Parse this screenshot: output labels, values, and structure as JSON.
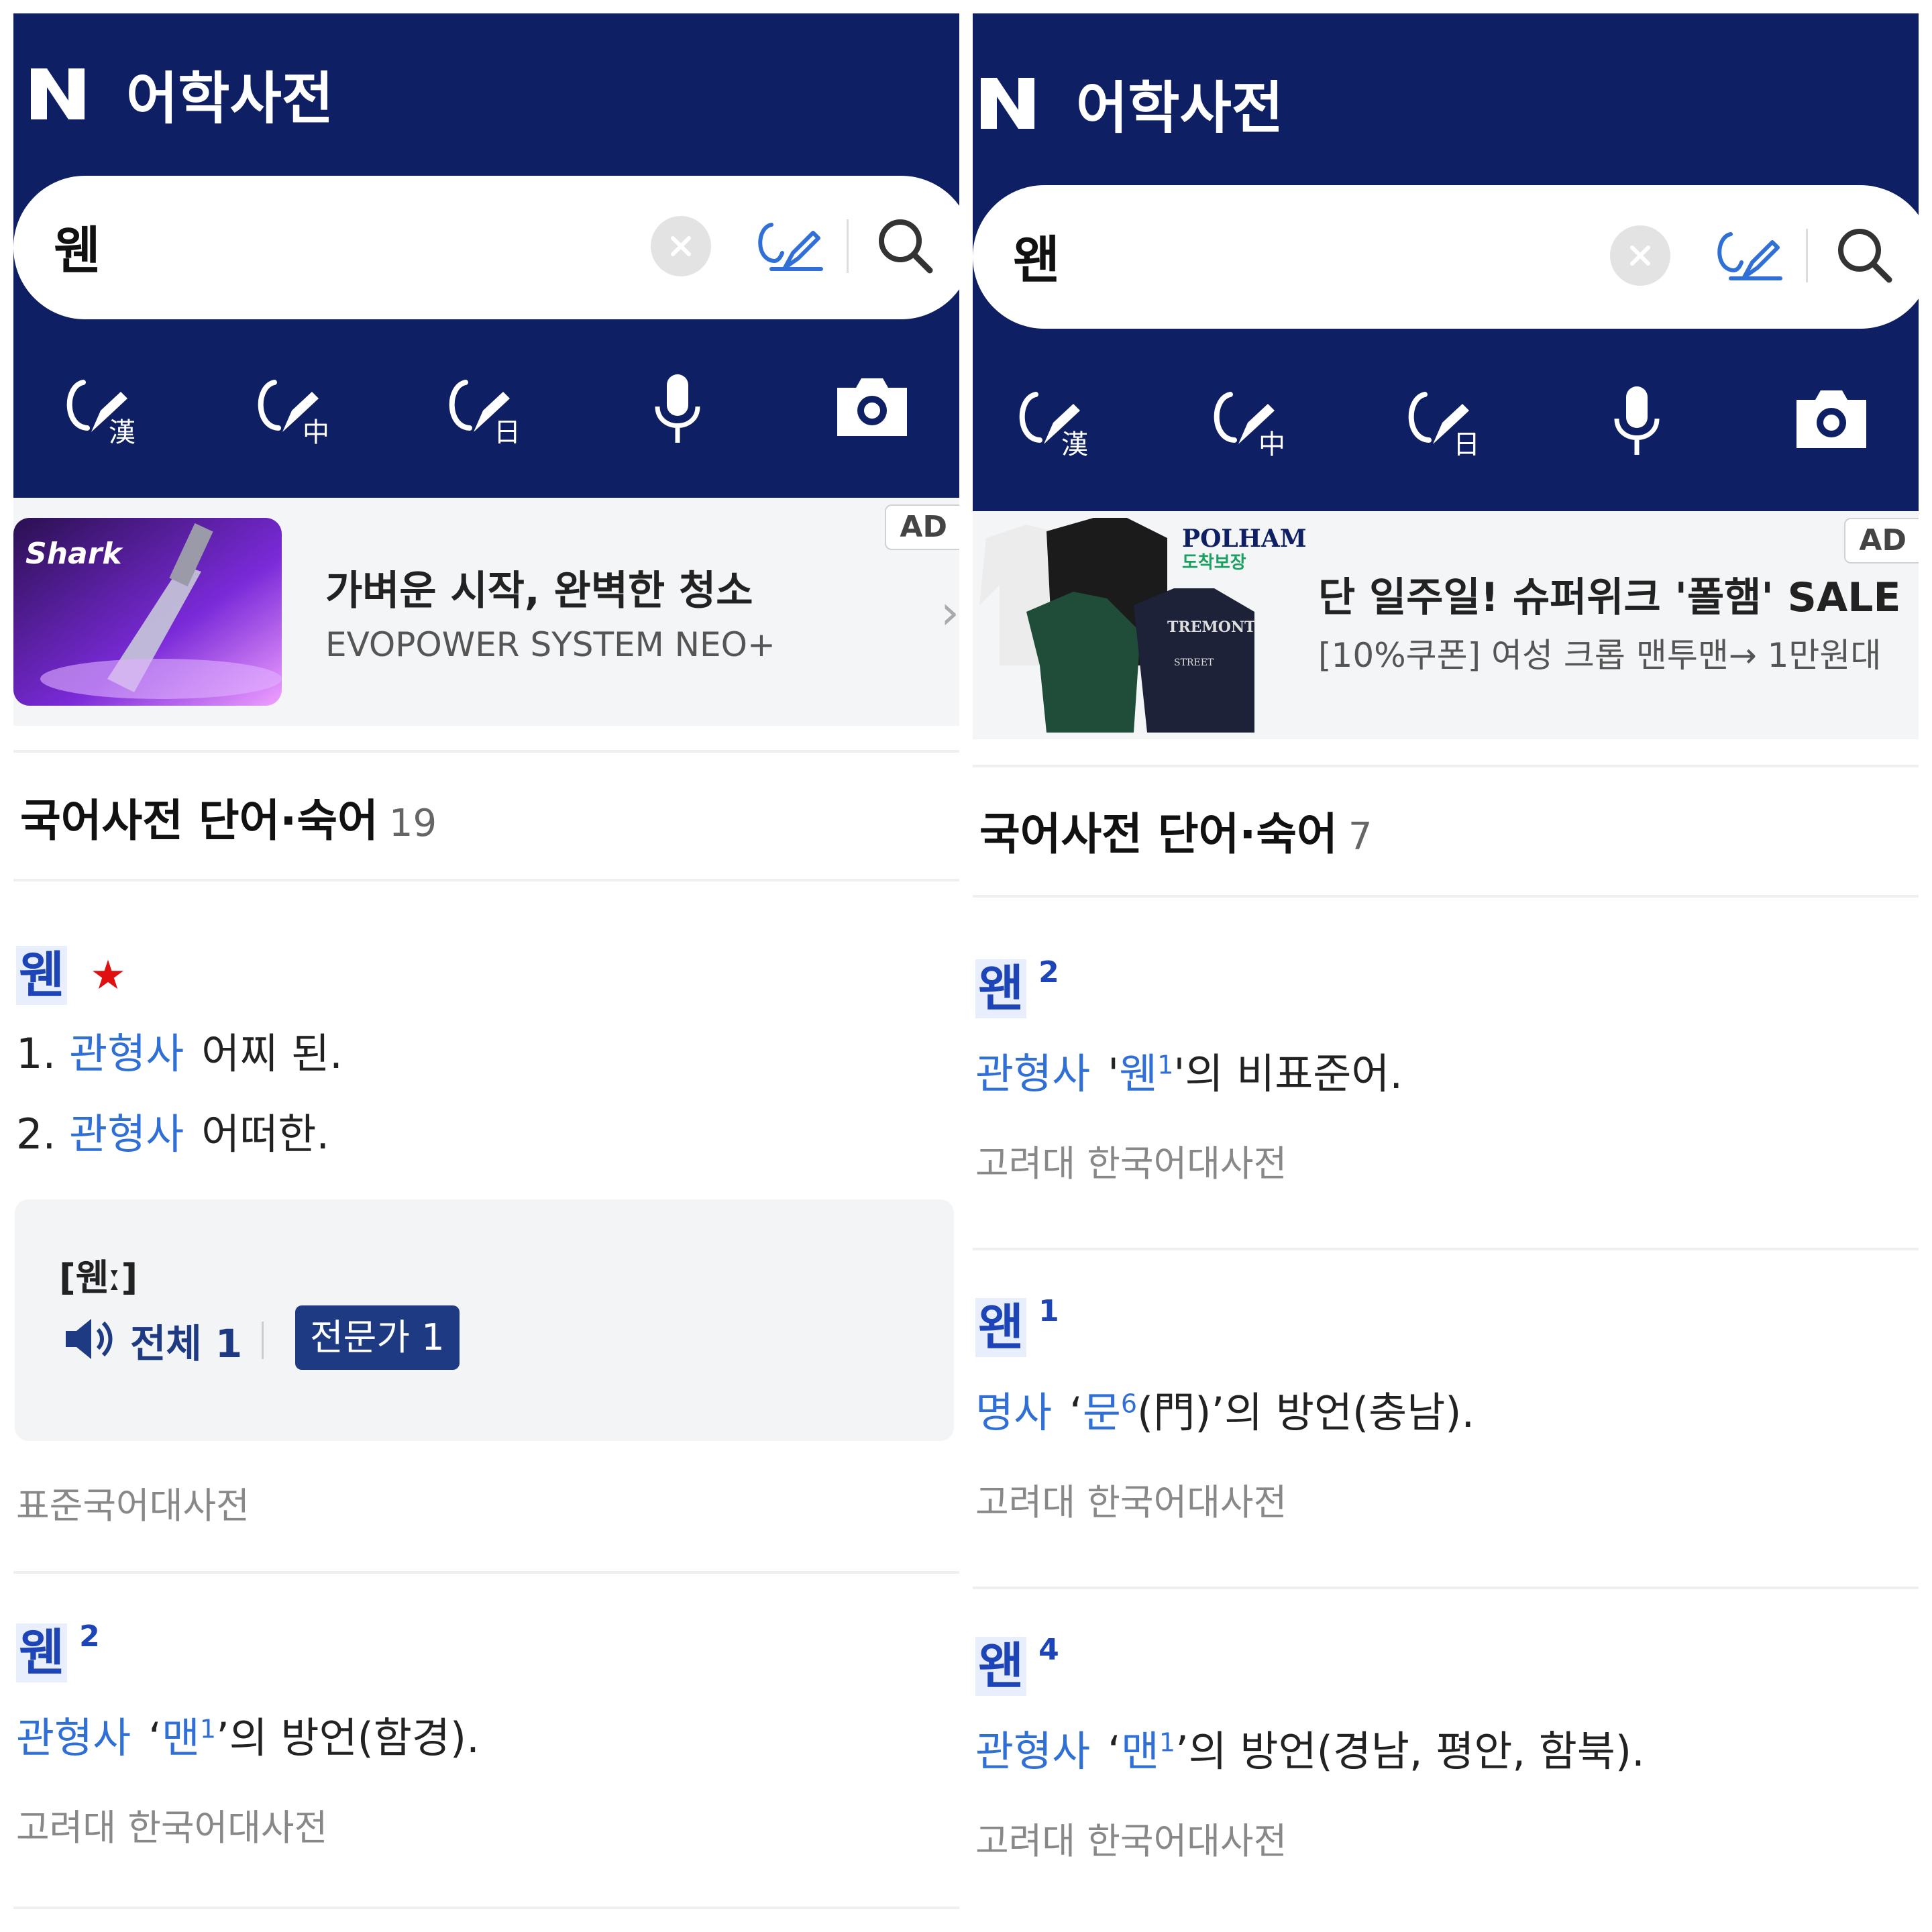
{
  "left": {
    "app_title": "어학사전",
    "search": {
      "value": "웬"
    },
    "ad": {
      "badge": "AD",
      "brand": "Shark",
      "title": "가벼운 시작, 완벽한 청소",
      "subtitle": "EVOPOWER SYSTEM NEO+"
    },
    "section": {
      "title": "국어사전 단어·숙어",
      "count": "19"
    },
    "entries": [
      {
        "term": "웬",
        "senses": [
          {
            "number": "1.",
            "pos": "관형사",
            "text": "어찌 된."
          },
          {
            "number": "2.",
            "pos": "관형사",
            "text": "어떠한."
          }
        ],
        "pronunciation": "[웬ː]",
        "audio_all_label": "전체 1",
        "expert_label": "전문가 1",
        "source": "표준국어대사전"
      },
      {
        "term": "웬",
        "sup": "2",
        "pos": "관형사",
        "ref": "맨",
        "ref_sup": "1",
        "rest": "의 방언(함경).",
        "source": "고려대 한국어대사전"
      }
    ]
  },
  "right": {
    "app_title": "어학사전",
    "search": {
      "value": "왠"
    },
    "ad": {
      "badge": "AD",
      "brand": "POLHAM",
      "brand_tag": "도착보장",
      "title": "단 일주일! 슈퍼위크 '폴햄' SALE",
      "subtitle": "[10%쿠폰] 여성 크롭 맨투맨→ 1만원대"
    },
    "section": {
      "title": "국어사전 단어·숙어",
      "count": "7"
    },
    "entries": [
      {
        "term": "왠",
        "sup": "2",
        "pos": "관형사",
        "ref": "웬",
        "ref_sup": "1",
        "rest": "의 비표준어.",
        "source": "고려대 한국어대사전"
      },
      {
        "term": "왠",
        "sup": "1",
        "pos": "명사",
        "ref": "문",
        "ref_sup": "6",
        "ref_hanja": "(門)",
        "rest": "의 방언(충남).",
        "source": "고려대 한국어대사전"
      },
      {
        "term": "왠",
        "sup": "4",
        "pos": "관형사",
        "ref": "맨",
        "ref_sup": "1",
        "rest": "의 방언(경남, 평안, 함북).",
        "source": "고려대 한국어대사전"
      }
    ]
  },
  "colors": {
    "header": "#0e2063",
    "term": "#1d45b8",
    "pos": "#2f6fd6",
    "star": "#e01010"
  },
  "icons": [
    "n-logo-icon",
    "clear-icon",
    "handwriting-icon",
    "search-icon",
    "hanja-handwriting-icon",
    "chinese-handwriting-icon",
    "japanese-handwriting-icon",
    "microphone-icon",
    "camera-icon",
    "speaker-icon",
    "star-icon",
    "chevron-right-icon"
  ]
}
